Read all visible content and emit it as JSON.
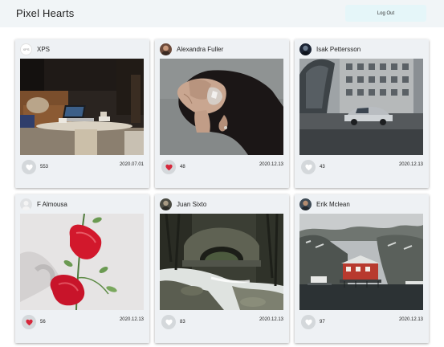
{
  "header": {
    "title": "Pixel Hearts",
    "logout_label": "Log Out"
  },
  "colors": {
    "header_bg": "#f1f5f7",
    "logout_bg": "#e5f6f9",
    "card_bg": "#eef1f4",
    "like_bg": "#d4d8db",
    "heart_liked": "#d6283b",
    "heart_unliked": "#ffffff"
  },
  "posts": [
    {
      "user": "XPS",
      "avatar_icon": "xps-logo-icon",
      "likes": "553",
      "date": "2020.07.01",
      "liked": false,
      "photo": "laptop on coffee table in living room"
    },
    {
      "user": "Alexandra Fuller",
      "avatar_icon": "user-avatar",
      "likes": "48",
      "date": "2020.12.13",
      "liked": true,
      "photo": "woman lying with glitter on face"
    },
    {
      "user": "Isak Pettersson",
      "avatar_icon": "user-avatar",
      "likes": "43",
      "date": "2020.12.13",
      "liked": false,
      "photo": "car parked by modern building"
    },
    {
      "user": "F Almousa",
      "avatar_icon": "default-avatar",
      "likes": "56",
      "date": "2020.12.13",
      "liked": true,
      "photo": "red anthurium flowers on white"
    },
    {
      "user": "Juan Sixto",
      "avatar_icon": "user-avatar",
      "likes": "83",
      "date": "2020.12.13",
      "liked": false,
      "photo": "stone bridge over forest stream"
    },
    {
      "user": "Erik Mclean",
      "avatar_icon": "user-avatar",
      "likes": "97",
      "date": "2020.12.13",
      "liked": false,
      "photo": "red house by fjord in snow"
    }
  ]
}
